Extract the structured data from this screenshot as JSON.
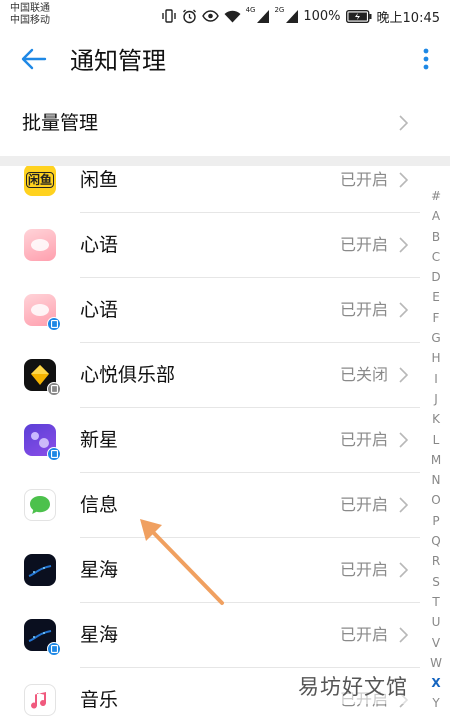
{
  "status_bar": {
    "carrier_1": "中国联通",
    "carrier_2": "中国移动",
    "net_type_1": "4G",
    "net_type_2": "2G",
    "battery": "100%",
    "time": "晚上10:45"
  },
  "header": {
    "title": "通知管理",
    "back_icon": "arrow-left-icon",
    "more_icon": "more-vertical-icon"
  },
  "batch": {
    "label": "批量管理"
  },
  "apps": [
    {
      "name": "闲鱼",
      "status": "已开启",
      "icon": "xianyu-app-icon",
      "icon_text": "闲鱼",
      "badge": false
    },
    {
      "name": "心语",
      "status": "已开启",
      "icon": "xinyu-app-icon",
      "badge": false
    },
    {
      "name": "心语",
      "status": "已开启",
      "icon": "xinyu-app-icon",
      "badge": true
    },
    {
      "name": "心悦俱乐部",
      "status": "已关闭",
      "icon": "xinyue-club-app-icon",
      "badge": true
    },
    {
      "name": "新星",
      "status": "已开启",
      "icon": "xinxing-app-icon",
      "badge": true
    },
    {
      "name": "信息",
      "status": "已开启",
      "icon": "messages-app-icon",
      "badge": false
    },
    {
      "name": "星海",
      "status": "已开启",
      "icon": "xinghai-app-icon",
      "badge": false
    },
    {
      "name": "星海",
      "status": "已开启",
      "icon": "xinghai-app-icon",
      "badge": true
    },
    {
      "name": "音乐",
      "status": "已开启",
      "icon": "music-app-icon",
      "badge": false
    }
  ],
  "index_bar": {
    "letters": [
      "#",
      "A",
      "B",
      "C",
      "D",
      "E",
      "F",
      "G",
      "H",
      "I",
      "J",
      "K",
      "L",
      "M",
      "N",
      "O",
      "P",
      "Q",
      "R",
      "S",
      "T",
      "U",
      "V",
      "W",
      "X",
      "Y"
    ],
    "active": "X"
  },
  "watermark": {
    "text": "易坊好文馆"
  },
  "colors": {
    "accent": "#1e88e5",
    "secondary_text": "#8a8a8a",
    "annotation_arrow": "#f0a060"
  }
}
